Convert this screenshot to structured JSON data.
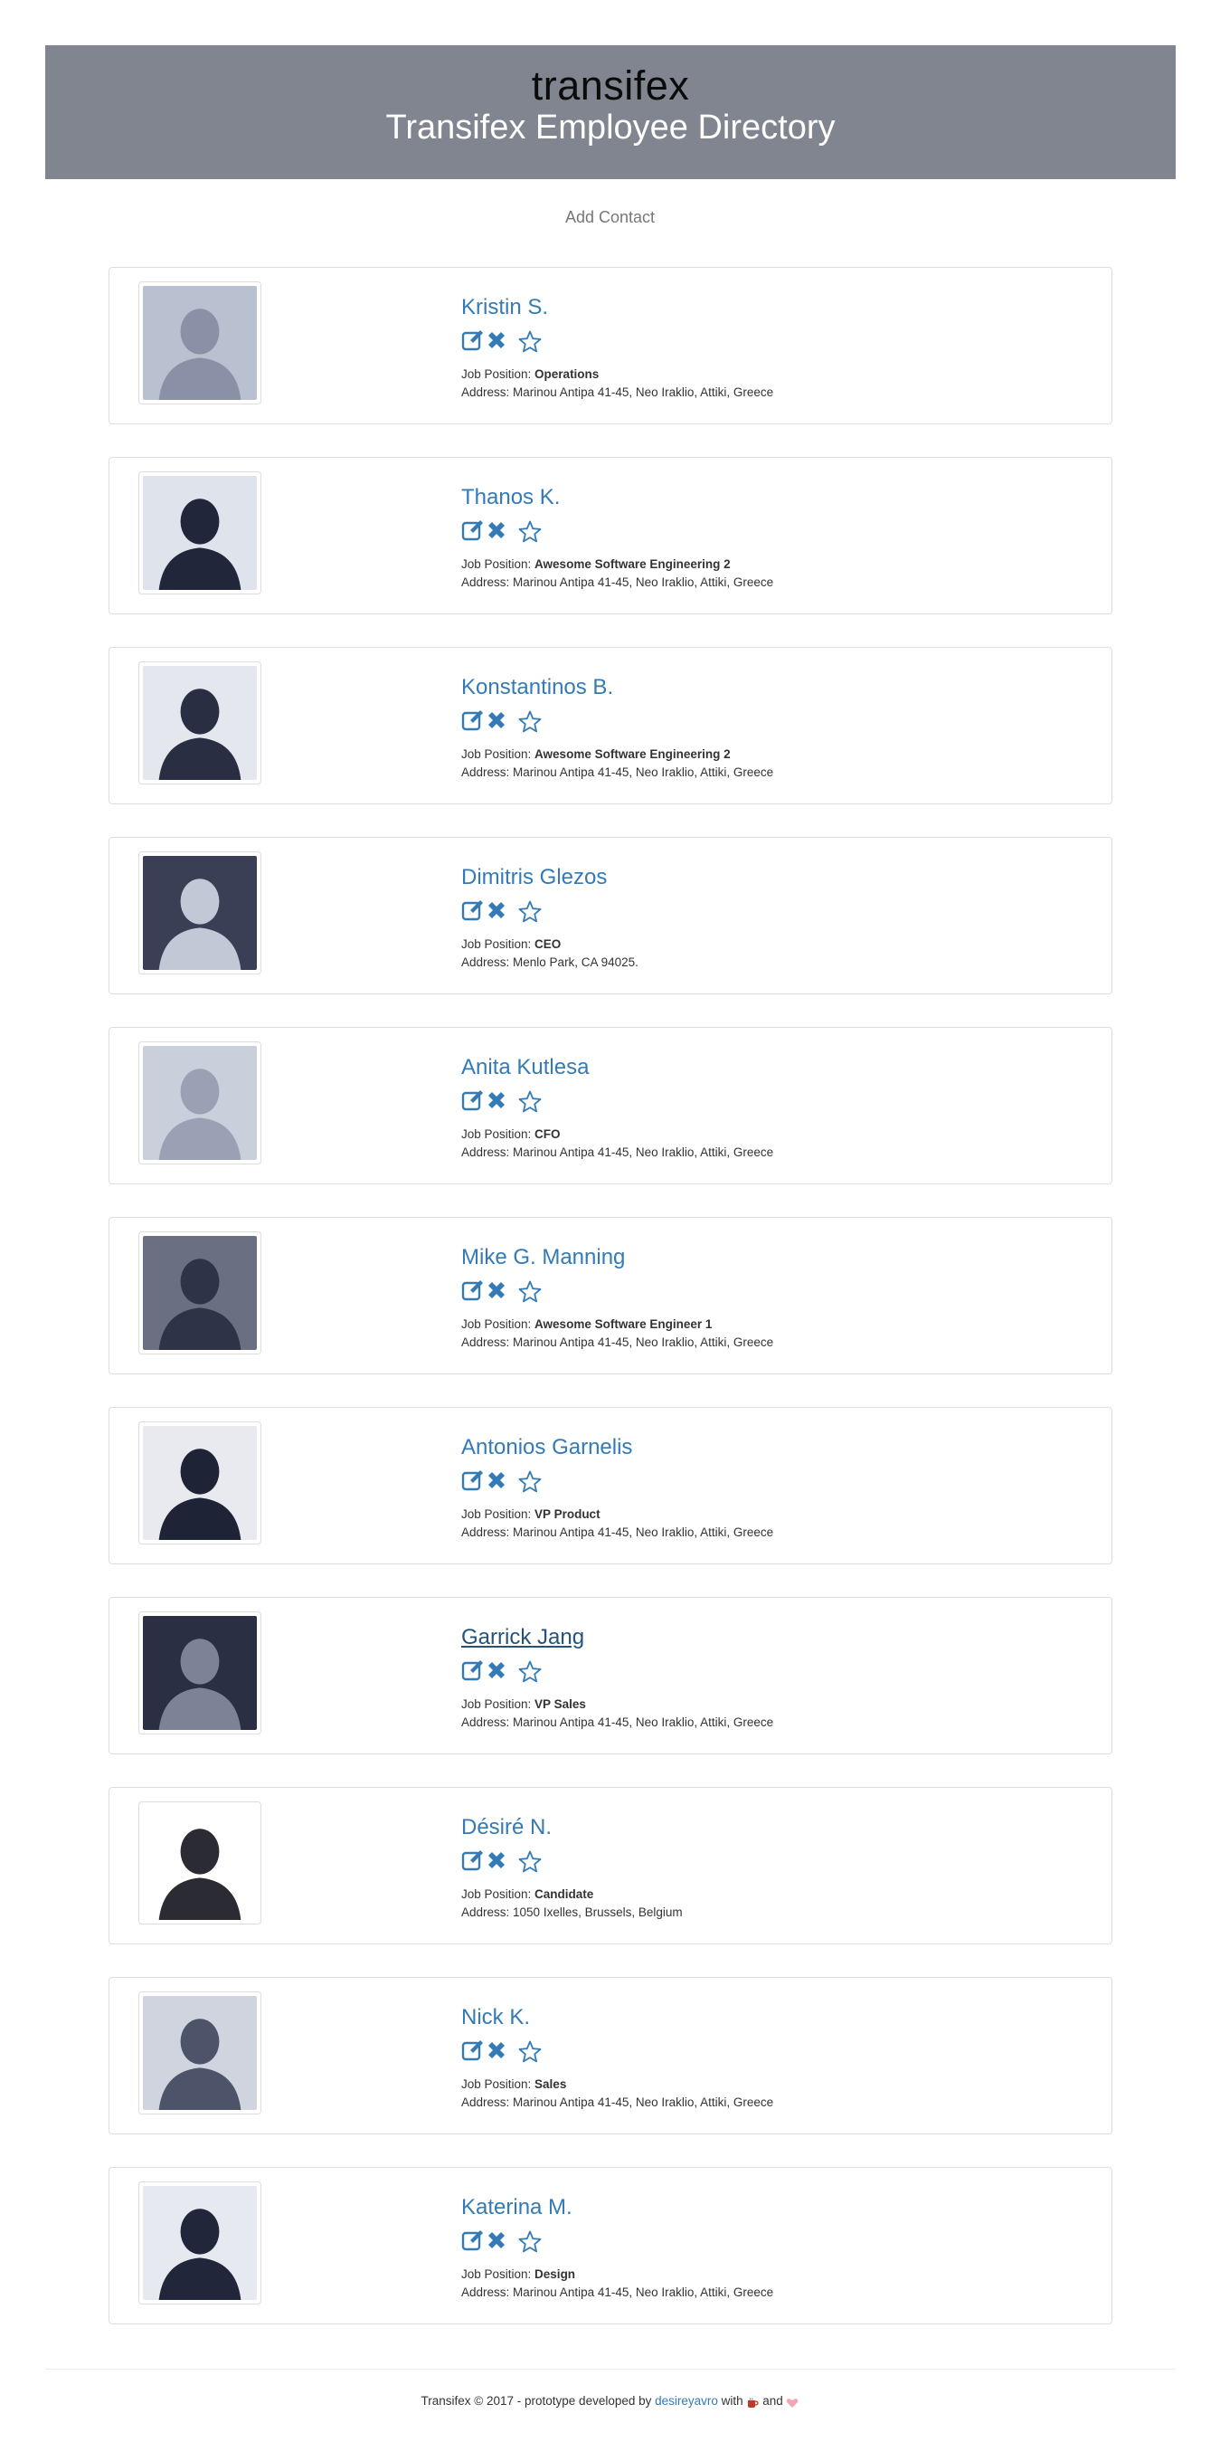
{
  "header": {
    "brand": "transifex",
    "title": "Transifex Employee Directory",
    "bg_color": "#808590"
  },
  "add_contact_label": "Add Contact",
  "labels": {
    "job_position": "Job Position: ",
    "address": "Address: "
  },
  "icons": {
    "edit": "edit-icon",
    "remove": "remove-icon",
    "favorite": "star-outline-icon",
    "accent_color": "#337ab7"
  },
  "contacts": [
    {
      "name": "Kristin S.",
      "position": "Operations",
      "address": "Marinou Antipa 41-45, Neo Iraklio, Attiki, Greece"
    },
    {
      "name": "Thanos K.",
      "position": "Awesome Software Engineering 2",
      "address": "Marinou Antipa 41-45, Neo Iraklio, Attiki, Greece"
    },
    {
      "name": "Konstantinos B.",
      "position": "Awesome Software Engineering 2",
      "address": "Marinou Antipa 41-45, Neo Iraklio, Attiki, Greece"
    },
    {
      "name": "Dimitris Glezos",
      "position": "CEO",
      "address": "Menlo Park, CA 94025."
    },
    {
      "name": "Anita Kutlesa",
      "position": "CFO",
      "address": "Marinou Antipa 41-45, Neo Iraklio, Attiki, Greece"
    },
    {
      "name": "Mike G. Manning",
      "position": "Awesome Software Engineer 1",
      "address": "Marinou Antipa 41-45, Neo Iraklio, Attiki, Greece"
    },
    {
      "name": "Antonios Garnelis",
      "position": "VP Product",
      "address": "Marinou Antipa 41-45, Neo Iraklio, Attiki, Greece"
    },
    {
      "name": "Garrick Jang",
      "position": "VP Sales",
      "address": "Marinou Antipa 41-45, Neo Iraklio, Attiki, Greece"
    },
    {
      "name": "Désiré N.",
      "position": "Candidate",
      "address": "1050 Ixelles, Brussels, Belgium"
    },
    {
      "name": "Nick K.",
      "position": "Sales",
      "address": "Marinou Antipa 41-45, Neo Iraklio, Attiki, Greece"
    },
    {
      "name": "Katerina M.",
      "position": "Design",
      "address": "Marinou Antipa 41-45, Neo Iraklio, Attiki, Greece"
    }
  ],
  "footer": {
    "prefix": "Transifex © 2017 - prototype developed by ",
    "author": "desireyavro",
    "with": " with ",
    "and": " and ",
    "coffee_icon": "coffee-icon",
    "heart_icon": "heart-icon"
  }
}
